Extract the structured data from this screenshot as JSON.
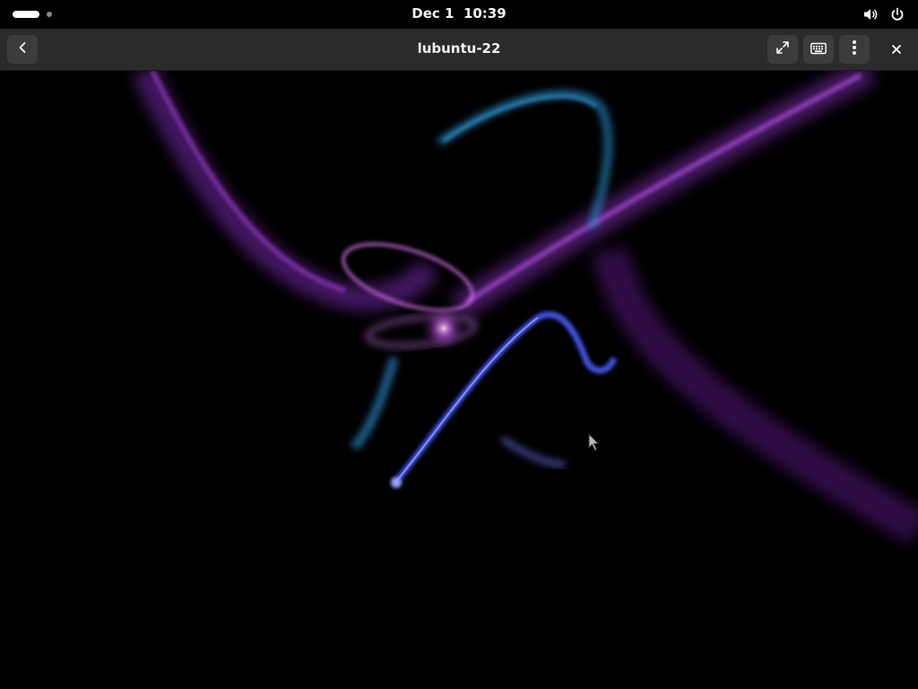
{
  "topbar": {
    "date": "Dec 1",
    "time": "10:39",
    "icons": [
      "volume-icon",
      "power-icon"
    ]
  },
  "headerbar": {
    "title": "lubuntu-22",
    "buttons": [
      "back-icon",
      "fullscreen-icon",
      "keyboard-icon",
      "menu-dots-icon",
      "close-icon"
    ]
  },
  "colors": {
    "topbar_bg": "#000000",
    "headerbar_bg": "#2b2b2b",
    "button_bg": "#3c3c3c",
    "wallpaper_bg": "#000000",
    "ribbon_purple": "#a23ad6",
    "ribbon_blue": "#4a5cff",
    "ribbon_cyan": "#2fa8e8"
  }
}
